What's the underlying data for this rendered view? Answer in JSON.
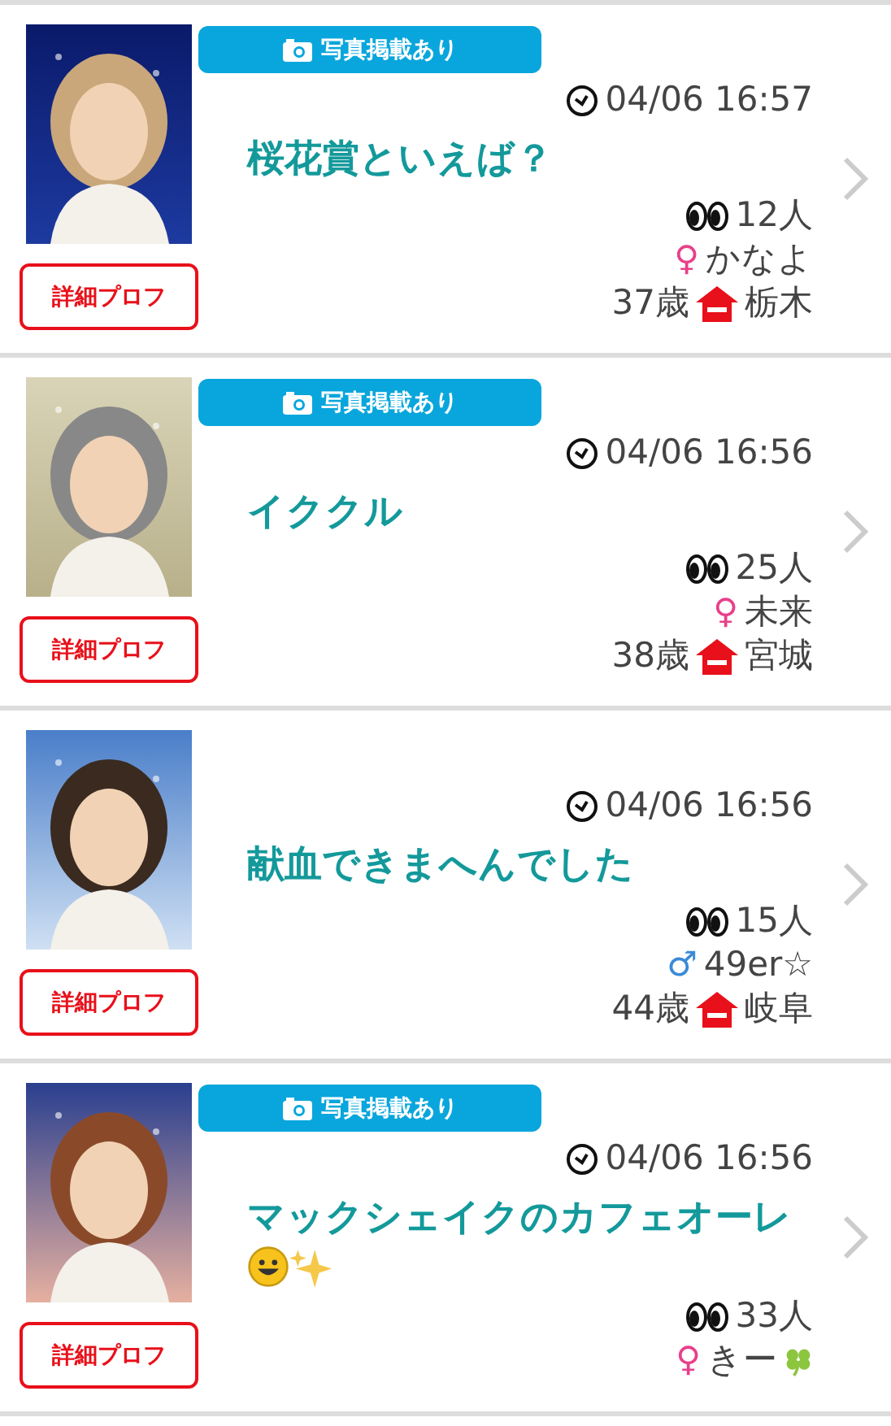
{
  "posts": [
    {
      "photo_badge": "写真掲載あり",
      "time": "04/06 16:57",
      "title": "桜花賞といえば？",
      "views": "12人",
      "gender": {
        "symbol": "♀",
        "color": "#e8408a"
      },
      "name": "かなよ",
      "age": "37歳",
      "region": "栃木",
      "profile_button": "詳細プロフ"
    },
    {
      "photo_badge": "写真掲載あり",
      "time": "04/06 16:56",
      "title": "イククル",
      "views": "25人",
      "gender": {
        "symbol": "♀",
        "color": "#e8408a"
      },
      "name": "未来",
      "age": "38歳",
      "region": "宮城",
      "profile_button": "詳細プロフ"
    },
    {
      "time": "04/06 16:56",
      "title": "献血できまへんでした",
      "views": "15人",
      "gender": {
        "symbol": "♂",
        "color": "#3a8ad8"
      },
      "name": "49er☆",
      "age": "44歳",
      "region": "岐阜",
      "profile_button": "詳細プロフ"
    },
    {
      "photo_badge": "写真掲載あり",
      "time": "04/06 16:56",
      "title": "マックシェイクのカフェオーレ",
      "title_icons": [
        {
          "kind": "smiley"
        },
        {
          "kind": "sparkles"
        }
      ],
      "views": "33人",
      "gender": {
        "symbol": "♀",
        "color": "#e8408a"
      },
      "name": "きー",
      "name_icon": {
        "kind": "clover"
      },
      "profile_button": "詳細プロフ"
    }
  ]
}
